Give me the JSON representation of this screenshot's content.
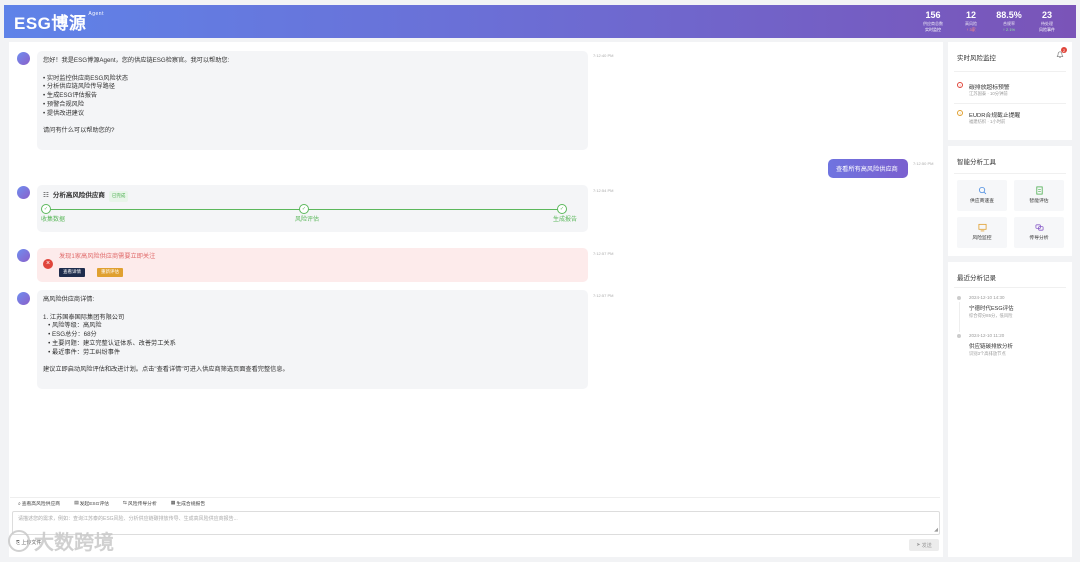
{
  "header": {
    "logo": "ESG博源",
    "logo_sup": "Agent",
    "stats": [
      {
        "num": "156",
        "label": "供应商总数",
        "sub": "实时监控",
        "sub_color": "#ffffff"
      },
      {
        "num": "12",
        "label": "高风险",
        "sub": "↑ 3家",
        "sub_color": "#ff8a80"
      },
      {
        "num": "88.5%",
        "label": "合规率",
        "sub": "↑ 2.1%",
        "sub_color": "#8fe3a0"
      },
      {
        "num": "23",
        "label": "待处理",
        "sub": "风险事件",
        "sub_color": "#ffffff"
      }
    ]
  },
  "chat": {
    "welcome": {
      "lines": [
        "您好！我是ESG博源Agent，您的供应链ESG检察官。我可以帮助您:",
        "",
        "• 实时监控供应商ESG风险状态",
        "• 分析供应链风险传导路径",
        "• 生成ESG评估报告",
        "• 预警合规风险",
        "• 提供改进建议",
        "",
        "请问有什么可以帮助您的?"
      ],
      "time": "7:12:40 PM"
    },
    "user_msg": {
      "text": "查看所有高风险供应商",
      "time": "7:12:50 PM"
    },
    "agent_task": {
      "title": "分析高风险供应商",
      "status": "已完成",
      "time": "7:12:54 PM",
      "steps": [
        "收集数据",
        "风险评估",
        "生成报告"
      ]
    },
    "alert": {
      "text": "发现1家高风险供应商需要立即关注",
      "btn_detail": "查看详情",
      "btn_eval": "重新评估",
      "time": "7:12:57 PM"
    },
    "detail": {
      "lines": [
        "高风险供应商详情:",
        "",
        "1. 江苏国泰国际集团有限公司",
        "   • 风险等级：高风险",
        "   • ESG总分：68分",
        "   • 主要问题：建立完整认证体系、改善劳工关系",
        "   • 最近事件：劳工纠纷事件",
        "",
        "建议立即启动风险评估和改进计划。点击\"查看详情\"可进入供应商筛选页面查看完整信息。"
      ],
      "time": "7:12:57 PM"
    }
  },
  "quick_actions": [
    "查看高风险供应商",
    "发起ESG评估",
    "风险传导分析",
    "生成合规报告"
  ],
  "input": {
    "placeholder": "请描述您的需求，例如：查询江苏泰的ESG风险、分析供应链碳排放传导、生成高风险供应商报告...",
    "upload": "上传文件",
    "send": "发送"
  },
  "watermark": "大数跨境",
  "right": {
    "monitor": {
      "title": "实时风险监控",
      "badge": "2",
      "items": [
        {
          "title": "碳排放超标预警",
          "sub": "江苏国泰 · 10分钟前",
          "color": "#e0453b",
          "icon": "!"
        },
        {
          "title": "EUDR合规截止提醒",
          "sub": "福建纺织 · 1小时前",
          "color": "#e0a030",
          "icon": "!"
        }
      ]
    },
    "tools": {
      "title": "智能分析工具",
      "items": [
        {
          "label": "供应商速查",
          "icon": "search-icon",
          "color": "#4a8ce0"
        },
        {
          "label": "智能评估",
          "icon": "doc-icon",
          "color": "#4caf50"
        },
        {
          "label": "风险监控",
          "icon": "monitor-icon",
          "color": "#e0a030"
        },
        {
          "label": "传导分析",
          "icon": "link-icon",
          "color": "#8a5fc9"
        }
      ]
    },
    "history": {
      "title": "最近分析记录",
      "items": [
        {
          "time": "2024-12-10 14:30",
          "title": "宁德时代ESG评估",
          "sub": "综合得分85分，低风险"
        },
        {
          "time": "2024-12-10 11:20",
          "title": "供应链碳排放分析",
          "sub": "识别3个高排放节点"
        }
      ]
    }
  }
}
